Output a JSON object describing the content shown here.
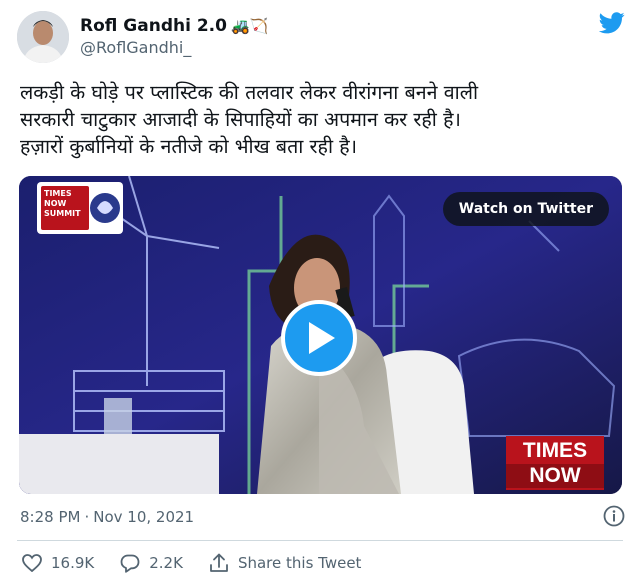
{
  "author": {
    "display_name": "Rofl Gandhi 2.0",
    "handle": "@RoflGandhi_",
    "name_emoji": "🚜🏹"
  },
  "tweet": {
    "lines": [
      "लकड़ी के घोड़े पर प्लास्टिक की तलवार लेकर वीरांगना बनने वाली",
      "सरकारी चाटुकार आजादी के सिपाहियों का अपमान कर रही है।",
      "हज़ारों कुर्बानियों के नतीजे को भीख बता रही है।"
    ]
  },
  "media": {
    "watch_label": "Watch on Twitter",
    "corner_logo_line1": "TIMES",
    "corner_logo_line2": "NOW",
    "corner_logo_line3": "SUMMIT",
    "ticker_line1": "TIMES",
    "ticker_line2": "NOW"
  },
  "meta": {
    "time": "8:28 PM",
    "separator": "·",
    "date": "Nov 10, 2021"
  },
  "actions": {
    "likes": "16.9K",
    "replies": "2.2K",
    "share_label": "Share this Tweet"
  },
  "colors": {
    "brand_blue": "#1d9bf0",
    "text_primary": "#0f1419",
    "text_secondary": "#536471",
    "divider": "#cfd9de"
  },
  "icons": [
    "twitter-bird-icon",
    "play-icon",
    "info-icon",
    "heart-icon",
    "reply-icon",
    "share-icon"
  ]
}
